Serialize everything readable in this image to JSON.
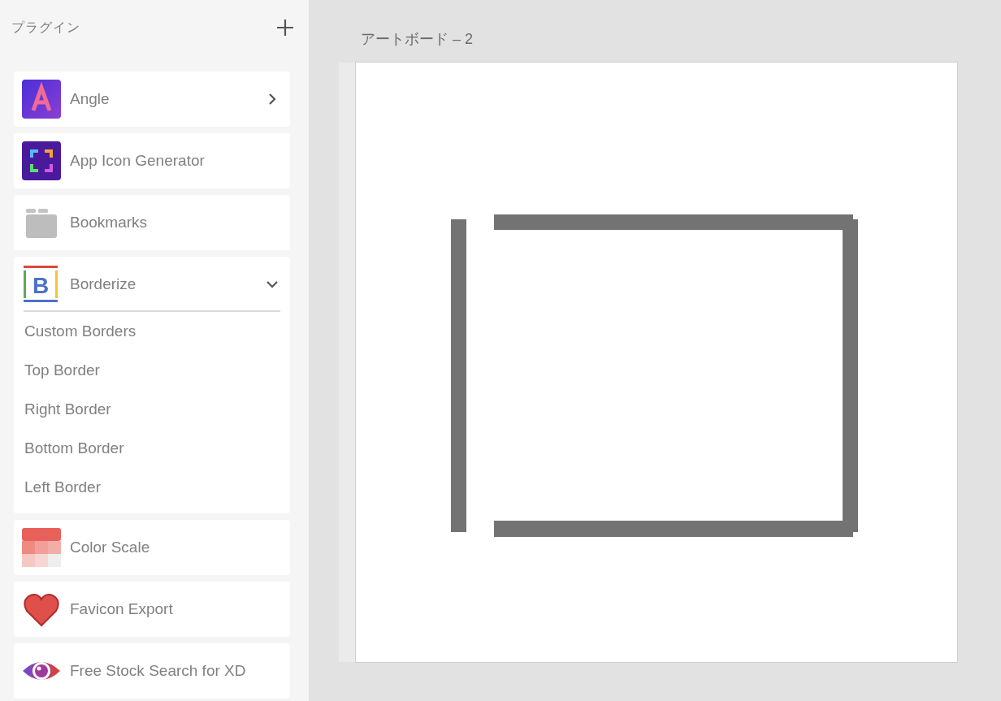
{
  "panel": {
    "title": "プラグイン"
  },
  "plugins": [
    {
      "name": "Angle",
      "kind": "menu",
      "expanded": false
    },
    {
      "name": "App Icon Generator",
      "kind": "command"
    },
    {
      "name": "Bookmarks",
      "kind": "command"
    },
    {
      "name": "Borderize",
      "icon_text": "B",
      "kind": "menu",
      "expanded": true,
      "children": [
        {
          "label": "Custom Borders"
        },
        {
          "label": "Top Border"
        },
        {
          "label": "Right Border"
        },
        {
          "label": "Bottom Border"
        },
        {
          "label": "Left Border"
        }
      ]
    },
    {
      "name": "Color Scale",
      "kind": "command"
    },
    {
      "name": "Favicon Export",
      "kind": "command"
    },
    {
      "name": "Free Stock Search for XD",
      "kind": "command"
    }
  ],
  "artboard": {
    "title": "アートボード – 2"
  }
}
